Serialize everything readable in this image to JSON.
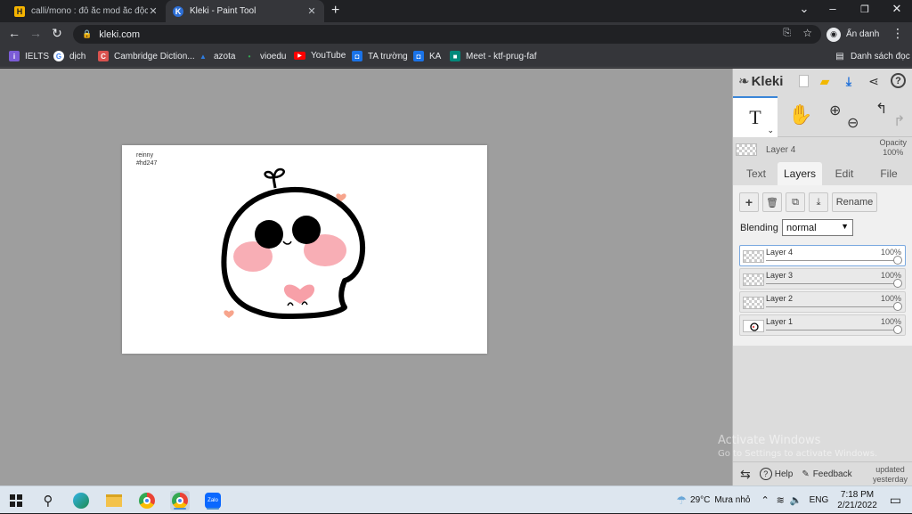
{
  "browser": {
    "tabs": [
      {
        "title": "calli/mono : đô ắc mod ắc độc vì",
        "favicon": "H",
        "active": false
      },
      {
        "title": "Kleki - Paint Tool",
        "favicon": "K",
        "active": true
      }
    ],
    "url": "kleki.com",
    "profile_label": "Ẩn danh",
    "bookmarks": [
      {
        "label": "IELTS",
        "color": "#7b5cd6"
      },
      {
        "label": "dịch",
        "color": "#4285f4"
      },
      {
        "label": "Cambridge Diction...",
        "color": "#d9534f"
      },
      {
        "label": "azota",
        "color": "#2f7de1"
      },
      {
        "label": "vioedu",
        "color": "#34a853"
      },
      {
        "label": "YouTube",
        "color": "#ff0000"
      },
      {
        "label": "TA trường",
        "color": "#1a73e8"
      },
      {
        "label": "KA",
        "color": "#1a73e8"
      },
      {
        "label": "Meet - ktf-prug-faf",
        "color": "#00897b"
      }
    ],
    "reading_list": "Danh sách đọc"
  },
  "app": {
    "logo": "Kleki",
    "canvas_signature": [
      "reinny",
      "#hd247"
    ],
    "current_layer": {
      "name": "Layer 4",
      "opacity_label": "Opacity",
      "opacity_value": "100%"
    },
    "panel_tabs": [
      "Text",
      "Layers",
      "Edit",
      "File"
    ],
    "active_tab": "Layers",
    "rename_label": "Rename",
    "blending_label": "Blending",
    "blending_value": "normal",
    "layers": [
      {
        "name": "Layer 4",
        "opacity": "100%",
        "selected": true
      },
      {
        "name": "Layer 3",
        "opacity": "100%",
        "selected": false
      },
      {
        "name": "Layer 2",
        "opacity": "100%",
        "selected": false
      },
      {
        "name": "Layer 1",
        "opacity": "100%",
        "selected": false
      }
    ],
    "help_label": "Help",
    "feedback_label": "Feedback",
    "updated_label": [
      "updated",
      "yesterday"
    ]
  },
  "watermark": {
    "line1": "Activate Windows",
    "line2": "Go to Settings to activate Windows."
  },
  "taskbar": {
    "weather_temp": "29°C",
    "weather_text": "Mưa nhỏ",
    "lang": "ENG",
    "time": "7:18 PM",
    "date": "2/21/2022"
  }
}
